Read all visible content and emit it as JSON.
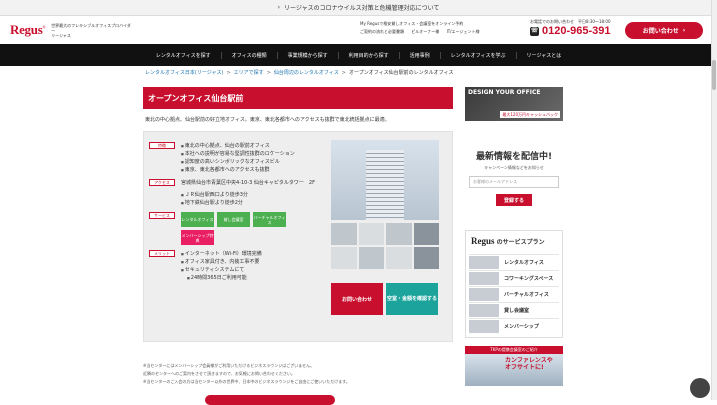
{
  "topbar": {
    "notice": "リージャスのコロナウイルス対策と危機管理対応について"
  },
  "header": {
    "logo": "Regus",
    "tagline_1": "世界最大のフレキシブルオフィスプロバイダー",
    "tagline_2": "リージャス",
    "link_1": "My Regusで格安貸しオフィス・会議室をオンライン予約",
    "link_2": "ご契約の流れと必要書類",
    "link_3": "ピルオーナー様",
    "link_4": "IT/エージェント様",
    "phone_note": "お電話でのお問い合わせ　平日8:30〜18:00",
    "phone": "0120-965-391",
    "contact_btn": "お問い合わせ"
  },
  "nav": [
    "レンタルオフィスを探す",
    "オフィスの種類",
    "事業規模から探す",
    "利用目的から探す",
    "活用事例",
    "レンタルオフィスを学ぶ",
    "リージャスとは"
  ],
  "breadcrumb": {
    "b1": "レンタルオフィス日本(リージャス)",
    "b2": "エリアで探す",
    "b3": "仙台周辺のレンタルオフィス",
    "current": "オープンオフィス仙台駅前のレンタルオフィス"
  },
  "main": {
    "title": "オープンオフィス仙台駅前",
    "description": "東北の中心拠点、仙台駅前の好立地オフィス。東京、東北各都市へのアクセスも抜群で東北統括拠点に最適。",
    "labels": {
      "feature": "特徴",
      "access": "アクセス",
      "service": "サービス",
      "merit": "メリット"
    },
    "features": [
      "東北の中心拠点、仙台の駅前オフィス",
      "本社への説明が容易な堅調性抜群のロケーション",
      "認知度の高いシンボリックなオフィスビル",
      "東京、東北各都市へのアクセスも抜群"
    ],
    "address": "宮城県仙台市青葉区中央4-10-3 仙台キャピタルタワー　2F",
    "access": [
      "ＪＲ仙台駅西口より徒歩3分",
      "地下鉄仙台駅より徒歩2分"
    ],
    "services": [
      "レンタルオフィス",
      "貸し会議室",
      "バーチャルオフィス",
      "メンバーシップ特典"
    ],
    "merits": [
      "インターネット（Wi-Fi）環境完備",
      "オフィス家具付き、内装工事不要",
      "セキュリティシステムにて",
      "24時間365日ご利用可能"
    ],
    "btn_contact": "お問い合わせ",
    "btn_check": "空室・金額を確認する"
  },
  "notes": [
    "※当センターにはメンバーシップ会員様がご利用いただけるビジネスラウンジはございません。",
    "近隣のセンターへのご案内をさせて頂きますので、お気軽にお問い合わせください。",
    "※当センターのご入会の方は当センター以外の世界中、日本中のビジネスラウンジをご自由にご使いいただけます。"
  ],
  "side": {
    "banner_title": "DESIGN YOUR OFFICE",
    "banner_badge": "最大120万円キャッシュバック",
    "latest_title": "最新情報を配信中!",
    "latest_sub": "キャンペーン情報などをお知らせ",
    "email_placeholder": "お客様のメールアドレス",
    "register_btn": "登録する",
    "services_logo": "Regus",
    "services_title": "のサービスプラン",
    "services": [
      "レンタルオフィス",
      "コワーキングスペース",
      "バーチャルオフィス",
      "貸し会議室",
      "メンバーシップ"
    ],
    "tkp_head": "TKPの提携会議室のご紹介",
    "tkp_body_1": "カンファレンスや",
    "tkp_body_2": "オフサイトに!"
  }
}
